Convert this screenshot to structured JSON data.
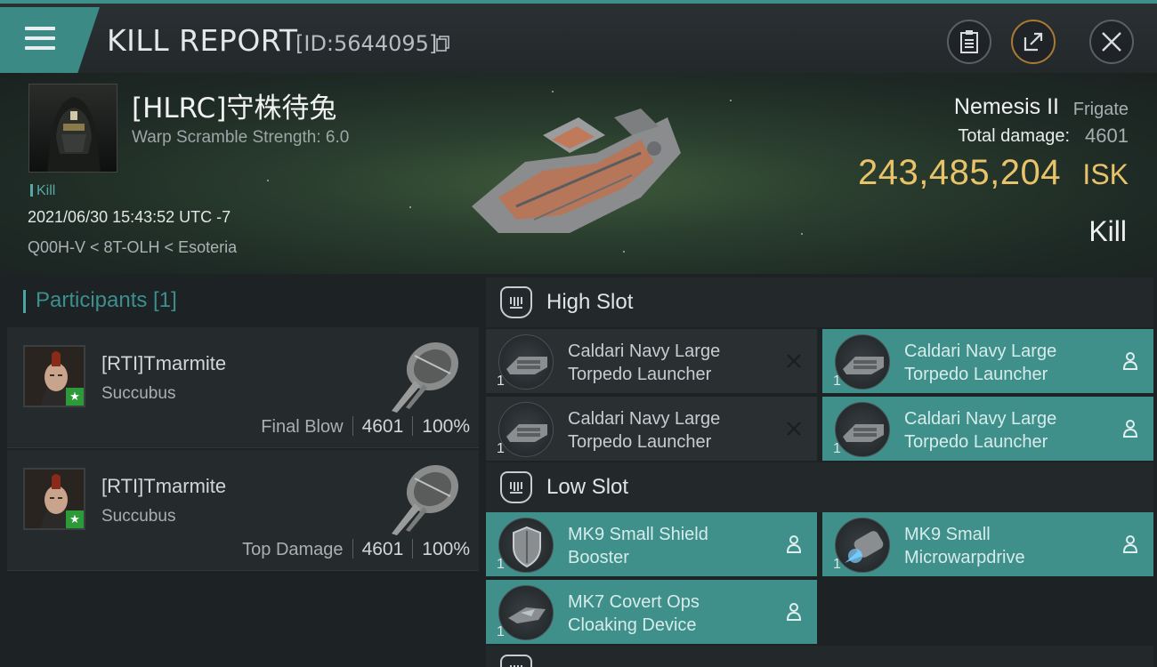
{
  "header": {
    "title": "KILL REPORT",
    "report_id": "[ID:5644095]"
  },
  "victim": {
    "name": "[HLRC]守株待兔",
    "warp_scramble": "Warp Scramble Strength: 6.0",
    "kill_tag": "Kill",
    "date": "2021/06/30 15:43:52 UTC -7",
    "location": "Q00H-V < 8T-OLH < Esoteria",
    "ship_name": "Nemesis II",
    "ship_class": "Frigate",
    "total_damage_label": "Total damage:",
    "total_damage": "4601",
    "isk_value": "243,485,204",
    "isk_unit": "ISK",
    "result": "Kill"
  },
  "participants": {
    "title": "Participants [1]",
    "items": [
      {
        "name": "[RTI]Tmarmite",
        "ship": "Succubus",
        "label": "Final Blow",
        "damage": "4601",
        "percent": "100%"
      },
      {
        "name": "[RTI]Tmarmite",
        "ship": "Succubus",
        "label": "Top Damage",
        "damage": "4601",
        "percent": "100%"
      }
    ]
  },
  "fitting": {
    "high_slot_title": "High Slot",
    "low_slot_title": "Low Slot",
    "high": [
      {
        "line1": "Caldari Navy Large",
        "line2": "Torpedo Launcher",
        "qty": "1",
        "status": "destroyed"
      },
      {
        "line1": "Caldari Navy Large",
        "line2": "Torpedo Launcher",
        "qty": "1",
        "status": "dropped"
      },
      {
        "line1": "Caldari Navy Large",
        "line2": "Torpedo Launcher",
        "qty": "1",
        "status": "destroyed"
      },
      {
        "line1": "Caldari Navy Large",
        "line2": "Torpedo Launcher",
        "qty": "1",
        "status": "dropped"
      }
    ],
    "low": [
      {
        "line1": "MK9 Small Shield",
        "line2": "Booster",
        "qty": "1",
        "status": "dropped"
      },
      {
        "line1": "MK9 Small",
        "line2": "Microwarpdrive",
        "qty": "1",
        "status": "dropped"
      },
      {
        "line1": "MK7 Covert Ops",
        "line2": "Cloaking Device",
        "qty": "1",
        "status": "dropped"
      }
    ]
  },
  "colors": {
    "accent_teal": "#3f8f8a",
    "isk_gold": "#e8c36a"
  },
  "icons": [
    "menu-icon",
    "copy-icon",
    "clipboard-icon",
    "share-icon",
    "close-icon",
    "person-icon",
    "x-icon",
    "slot-icon"
  ]
}
